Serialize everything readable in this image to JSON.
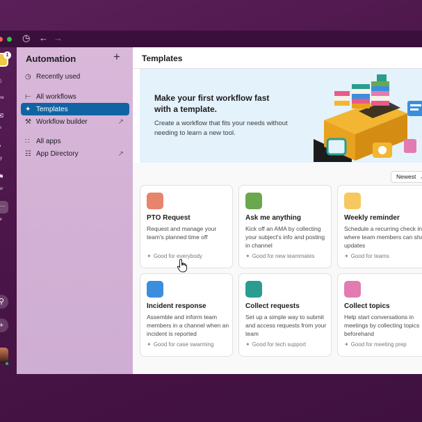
{
  "rail": {
    "badge_count": "1",
    "items": [
      {
        "icon": "home-icon",
        "label": "ome"
      },
      {
        "icon": "dm-icon",
        "label": "Ms"
      },
      {
        "icon": "bell-icon",
        "label": "vity"
      },
      {
        "icon": "bookmark-icon",
        "label": "ater"
      },
      {
        "icon": "more-icon",
        "label": "ore"
      }
    ],
    "search_icon": "search-icon",
    "add_icon": "plus-icon"
  },
  "sidebar": {
    "title": "Automation",
    "items": [
      {
        "label": "Recently used",
        "icon": "clock-icon"
      },
      {
        "label": "All workflows",
        "icon": "workflow-icon"
      },
      {
        "label": "Templates",
        "icon": "templates-icon",
        "active": true
      },
      {
        "label": "Workflow builder",
        "icon": "builder-icon",
        "external": true
      },
      {
        "label": "All apps",
        "icon": "apps-icon"
      },
      {
        "label": "App Directory",
        "icon": "directory-icon",
        "external": true
      }
    ]
  },
  "main": {
    "title": "Templates",
    "hero": {
      "heading": "Make your first workflow fast with a template.",
      "body": "Create a workflow that fits your needs without needing to learn a new tool."
    },
    "sort_label": "Newest",
    "cards": [
      {
        "title": "PTO Request",
        "desc": "Request and manage your team's planned time off",
        "good_for": "Good for everybody",
        "tile_color": "#e8836c"
      },
      {
        "title": "Ask me anything",
        "desc": "Kick off an AMA by collecting your subject's info and posting in channel",
        "good_for": "Good for new teammates",
        "tile_color": "#6aa84f"
      },
      {
        "title": "Weekly reminder",
        "desc": "Schedule a recurring check in where team members can share updates",
        "good_for": "Good for teams",
        "tile_color": "#f6c85f"
      },
      {
        "title": "Incident response",
        "desc": "Assemble and inform team members in a channel when an incident is reported",
        "good_for": "Good for case swarming",
        "tile_color": "#3b8ede"
      },
      {
        "title": "Collect requests",
        "desc": "Set up a simple way to submit and access requests from your team",
        "good_for": "Good for tech support",
        "tile_color": "#2a9d8f"
      },
      {
        "title": "Collect topics",
        "desc": "Help start conversations in meetings by collecting topics beforehand",
        "good_for": "Good for meeting prep",
        "tile_color": "#e27bb1"
      }
    ]
  }
}
